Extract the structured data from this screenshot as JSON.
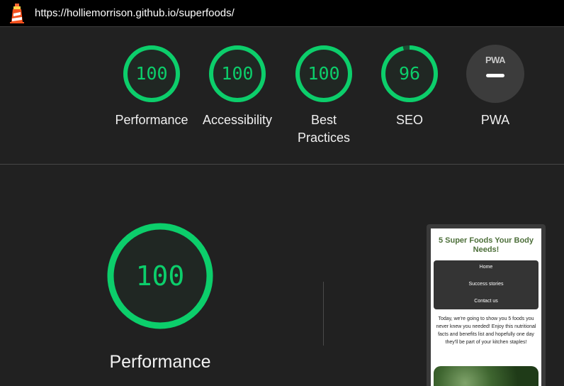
{
  "url_bar": {
    "url": "https://holliemorrison.github.io/superfoods/"
  },
  "colors": {
    "pass": "#0cce6b",
    "pass_fill": "#1f3a2a",
    "background": "#212121"
  },
  "scores": [
    {
      "label": "Performance",
      "value": "100",
      "score": 100
    },
    {
      "label": "Accessibility",
      "value": "100",
      "score": 100
    },
    {
      "label": "Best Practices",
      "value": "100",
      "score": 100
    },
    {
      "label": "SEO",
      "value": "96",
      "score": 96
    }
  ],
  "pwa": {
    "label": "PWA",
    "badge_text": "PWA"
  },
  "performance_section": {
    "value": "100",
    "score": 100,
    "label": "Performance"
  },
  "screenshot_preview": {
    "title": "5 Super Foods Your Body Needs!",
    "nav": [
      "Home",
      "Success stories",
      "Contact us"
    ],
    "body": "Today, we're going to show you 5 foods you never knew you needed! Enjoy this nutritional facts and benefits list and hopefully one day they'll be part of your kitchen staples!"
  }
}
